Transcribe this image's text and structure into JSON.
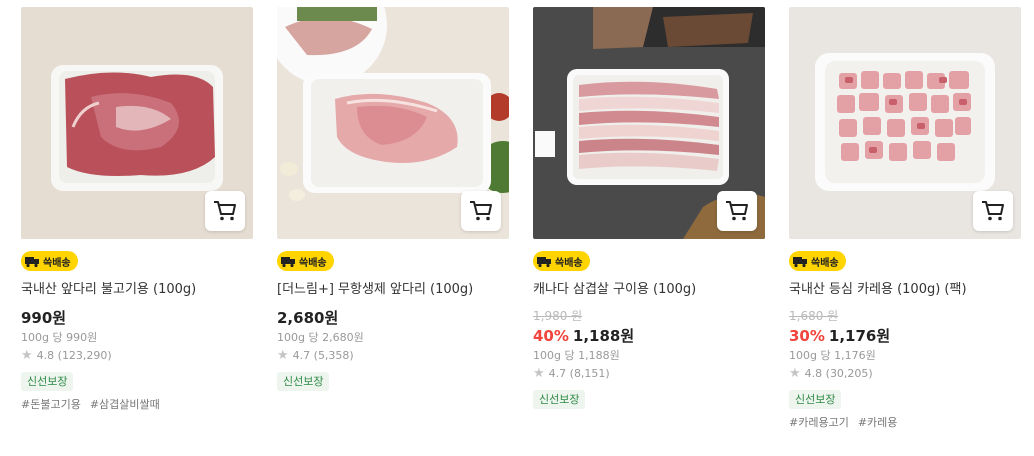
{
  "products": [
    {
      "badge": "쓱배송",
      "title": "국내산 앞다리 불고기용 (100g)",
      "original_price": "",
      "discount": "",
      "price": "990원",
      "unit_price": "100g 당 990원",
      "rating": "4.8 (123,290)",
      "guarantee": "신선보장",
      "tags": [
        "#돈불고기용",
        "#삼겹살비쌀때"
      ]
    },
    {
      "badge": "쓱배송",
      "title": "[더느림+] 무항생제 앞다리 (100g)",
      "original_price": "",
      "discount": "",
      "price": "2,680원",
      "unit_price": "100g 당 2,680원",
      "rating": "4.7 (5,358)",
      "guarantee": "신선보장",
      "tags": []
    },
    {
      "badge": "쓱배송",
      "title": "캐나다 삼겹살 구이용 (100g)",
      "original_price": "1,980 원",
      "discount": "40%",
      "price": "1,188원",
      "unit_price": "100g 당 1,188원",
      "rating": "4.7 (8,151)",
      "guarantee": "신선보장",
      "tags": []
    },
    {
      "badge": "쓱배송",
      "title": "국내산 등심 카레용 (100g) (팩)",
      "original_price": "1,680 원",
      "discount": "30%",
      "price": "1,176원",
      "unit_price": "100g 당 1,176원",
      "rating": "4.8 (30,205)",
      "guarantee": "신선보장",
      "tags": [
        "#카레용고기",
        "#카레용"
      ]
    }
  ],
  "colors": {
    "badge": "#ffd400",
    "discount": "#f0443c",
    "guarantee_text": "#2f8a47"
  },
  "icons": {
    "cart": "cart-icon",
    "delivery": "truck-icon",
    "star": "star-icon"
  }
}
